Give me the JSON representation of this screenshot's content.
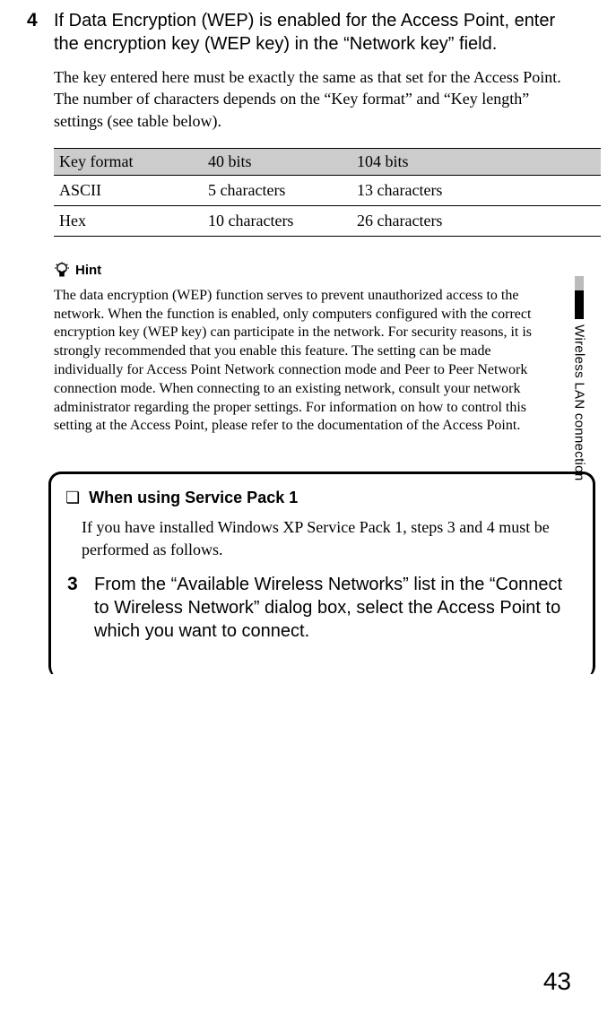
{
  "step4": {
    "number": "4",
    "title": "If Data Encryption (WEP) is enabled for the Access Point, enter the encryption key (WEP key) in the “Network key” field.",
    "desc": "The key entered here must be exactly the same as that set for the Access Point. The number of characters depends on the “Key format” and “Key length” settings (see table below)."
  },
  "table": {
    "headers": [
      "Key format",
      "40 bits",
      "104 bits"
    ],
    "rows": [
      [
        "ASCII",
        "5 characters",
        "13 characters"
      ],
      [
        "Hex",
        "10 characters",
        "26 characters"
      ]
    ]
  },
  "hint": {
    "label": "Hint",
    "text": "The data encryption (WEP) function serves to prevent unauthorized access to the network. When the function is enabled, only computers configured with the correct encryption key (WEP key) can participate in the network. For security reasons, it is strongly recommended that you enable this feature. The setting can be made individually for Access Point Network connection mode and Peer to Peer Network connection mode. When connecting to an existing network, consult your network administrator regarding the proper settings. For information on how to control this setting at the Access Point, please refer to the documentation of the Access Point."
  },
  "side_label": "Wireless LAN connection",
  "sp_box": {
    "bullet": "❏",
    "title": "When using Service Pack 1",
    "desc": "If you have installed Windows XP Service Pack 1, steps 3 and 4 must be performed as follows.",
    "step3_number": "3",
    "step3_title": "From the “Available Wireless Networks” list in the “Connect to Wireless Network” dialog box, select the Access Point to which you want to connect."
  },
  "page_number": "43"
}
